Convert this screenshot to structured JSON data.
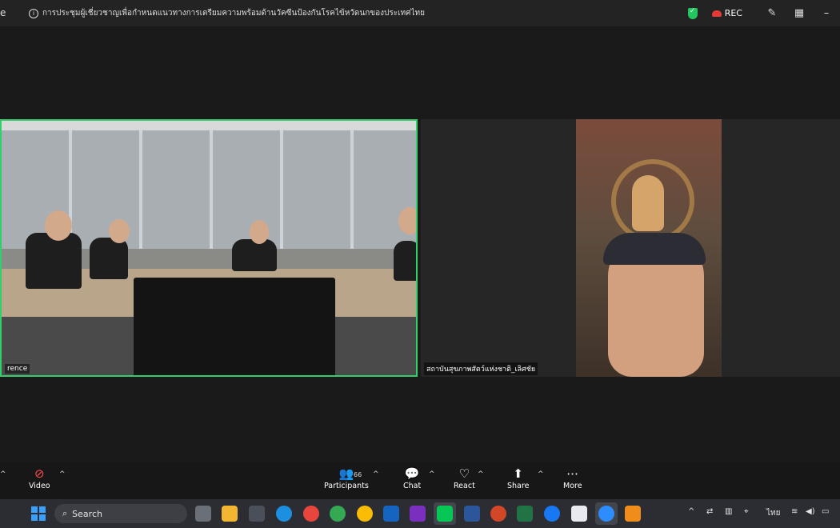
{
  "titlebar": {
    "app_name_fragment": "e",
    "meeting_info": "การประชุมผู้เชี่ยวชาญเพื่อกำหนดแนวทางการเตรียมความพร้อมด้านวัคซีนป้องกันโรคไข้หวัดนกของประเทศไทย",
    "rec_label": "REC",
    "colors": {
      "shield": "#22c55e",
      "rec_cloud": "#e53935"
    }
  },
  "tiles": {
    "left_label": "rence",
    "right_label": "สถาบันสุขภาพสัตว์แห่งชาติ_เลิศชัย",
    "active_speaker_border": "#2ed06b"
  },
  "toolbar": {
    "video_label": "Video",
    "participants_label": "Participants",
    "participants_count": "66",
    "chat_label": "Chat",
    "react_label": "React",
    "share_label": "Share",
    "more_label": "More"
  },
  "taskbar": {
    "search_label": "Search",
    "language": "ไทย",
    "icons": [
      "windows-start",
      "file-explorer",
      "calculator",
      "edge",
      "chrome",
      "chrome-alt",
      "chrome-profile",
      "outlook",
      "onenote",
      "line",
      "word",
      "powerpoint",
      "excel",
      "facebook",
      "app-w",
      "zoom",
      "app-orange"
    ]
  }
}
